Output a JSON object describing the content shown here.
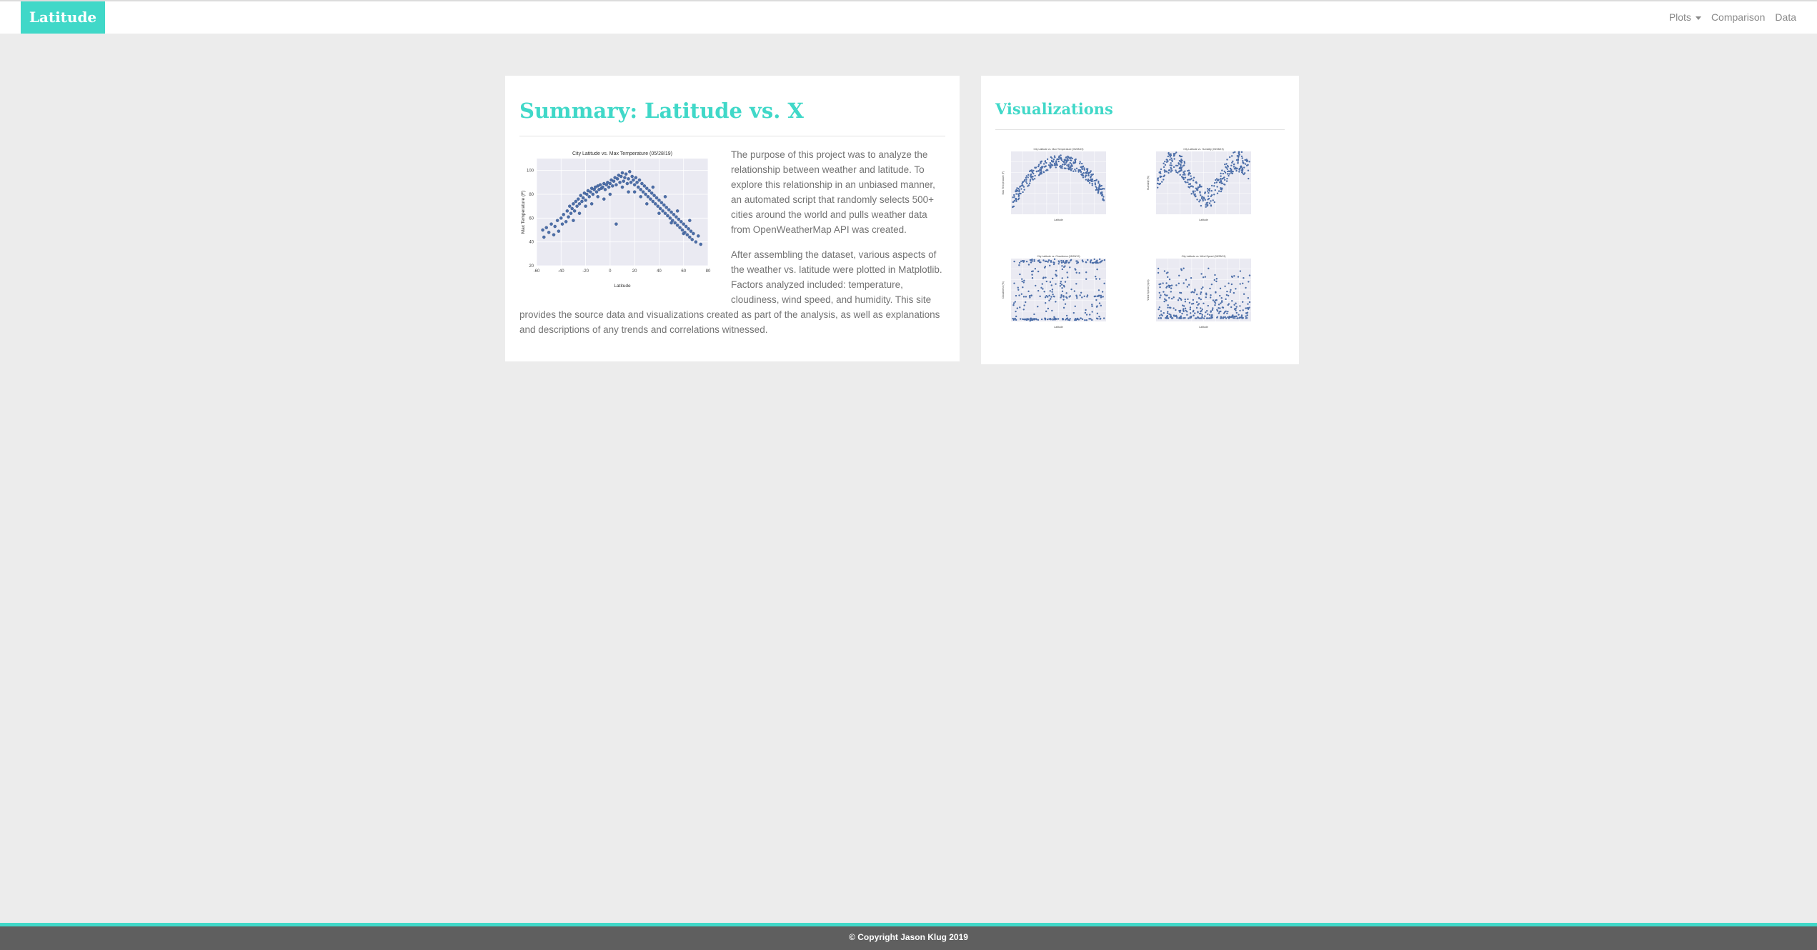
{
  "navbar": {
    "brand": "Latitude",
    "links": [
      {
        "label": "Plots",
        "dropdown": true
      },
      {
        "label": "Comparison",
        "dropdown": false
      },
      {
        "label": "Data",
        "dropdown": false
      }
    ]
  },
  "summary": {
    "title": "Summary: Latitude vs. X",
    "paragraphs": [
      "The purpose of this project was to analyze the relationship between weather and latitude. To explore this relationship in an unbiased manner, an automated script that randomly selects 500+ cities around the world and pulls weather data from OpenWeatherMap API was created.",
      "After assembling the dataset, various aspects of the weather vs. latitude were plotted in Matplotlib. Factors analyzed included: temperature, cloudiness, wind speed, and humidity. This site provides the source data and visualizations created as part of the analysis, as well as explanations and descriptions of any trends and correlations witnessed."
    ]
  },
  "visualizations": {
    "title": "Visualizations"
  },
  "footer": {
    "text": "© Copyright Jason Klug 2019"
  },
  "colors": {
    "accent": "#40d8c8",
    "page_bg": "#ececec",
    "footer_bg": "#5f5f5f",
    "plot_bg": "#eaeaf2",
    "point": "#4c6ea8"
  },
  "chart_data": [
    {
      "type": "scatter",
      "title": "City Latitude vs. Max Temperature (05/28/19)",
      "xlabel": "Latitude",
      "ylabel": "Max Temperature (F)",
      "xticks": [
        "-60",
        "-40",
        "-20",
        "0",
        "20",
        "40",
        "60",
        "80"
      ],
      "yticks": [
        "20",
        "40",
        "60",
        "80",
        "100"
      ],
      "xlim": [
        -60,
        80
      ],
      "ylim": [
        20,
        110
      ],
      "grid": true,
      "trend": "temperature peaks near latitude 0-20 and decreases toward both poles",
      "points": [
        [
          -55,
          50
        ],
        [
          -54,
          44
        ],
        [
          -52,
          52
        ],
        [
          -50,
          48
        ],
        [
          -48,
          55
        ],
        [
          -46,
          46
        ],
        [
          -45,
          53
        ],
        [
          -43,
          58
        ],
        [
          -42,
          49
        ],
        [
          -40,
          60
        ],
        [
          -39,
          55
        ],
        [
          -38,
          63
        ],
        [
          -36,
          57
        ],
        [
          -35,
          66
        ],
        [
          -34,
          61
        ],
        [
          -33,
          70
        ],
        [
          -32,
          64
        ],
        [
          -31,
          68
        ],
        [
          -30,
          72
        ],
        [
          -29,
          66
        ],
        [
          -28,
          74
        ],
        [
          -27,
          70
        ],
        [
          -26,
          76
        ],
        [
          -25,
          72
        ],
        [
          -24,
          79
        ],
        [
          -23,
          74
        ],
        [
          -22,
          77
        ],
        [
          -21,
          81
        ],
        [
          -20,
          75
        ],
        [
          -19,
          80
        ],
        [
          -18,
          83
        ],
        [
          -17,
          78
        ],
        [
          -16,
          82
        ],
        [
          -15,
          85
        ],
        [
          -14,
          80
        ],
        [
          -13,
          84
        ],
        [
          -12,
          86
        ],
        [
          -11,
          82
        ],
        [
          -10,
          87
        ],
        [
          -9,
          84
        ],
        [
          -8,
          88
        ],
        [
          -7,
          85
        ],
        [
          -6,
          86
        ],
        [
          -5,
          89
        ],
        [
          -4,
          84
        ],
        [
          -3,
          88
        ],
        [
          -2,
          90
        ],
        [
          -1,
          86
        ],
        [
          0,
          89
        ],
        [
          1,
          92
        ],
        [
          2,
          87
        ],
        [
          3,
          91
        ],
        [
          4,
          94
        ],
        [
          5,
          88
        ],
        [
          6,
          93
        ],
        [
          7,
          96
        ],
        [
          8,
          90
        ],
        [
          9,
          95
        ],
        [
          10,
          98
        ],
        [
          11,
          91
        ],
        [
          12,
          94
        ],
        [
          13,
          97
        ],
        [
          14,
          89
        ],
        [
          15,
          93
        ],
        [
          16,
          99
        ],
        [
          17,
          90
        ],
        [
          18,
          95
        ],
        [
          19,
          92
        ],
        [
          20,
          88
        ],
        [
          21,
          94
        ],
        [
          22,
          90
        ],
        [
          23,
          86
        ],
        [
          24,
          92
        ],
        [
          25,
          84
        ],
        [
          26,
          89
        ],
        [
          27,
          82
        ],
        [
          28,
          87
        ],
        [
          29,
          80
        ],
        [
          30,
          85
        ],
        [
          31,
          78
        ],
        [
          32,
          83
        ],
        [
          33,
          76
        ],
        [
          34,
          81
        ],
        [
          35,
          74
        ],
        [
          36,
          79
        ],
        [
          37,
          72
        ],
        [
          38,
          77
        ],
        [
          39,
          70
        ],
        [
          40,
          75
        ],
        [
          41,
          68
        ],
        [
          42,
          73
        ],
        [
          43,
          66
        ],
        [
          44,
          71
        ],
        [
          45,
          64
        ],
        [
          46,
          69
        ],
        [
          47,
          62
        ],
        [
          48,
          67
        ],
        [
          49,
          60
        ],
        [
          50,
          65
        ],
        [
          51,
          58
        ],
        [
          52,
          63
        ],
        [
          53,
          56
        ],
        [
          54,
          61
        ],
        [
          55,
          54
        ],
        [
          56,
          59
        ],
        [
          57,
          52
        ],
        [
          58,
          57
        ],
        [
          59,
          50
        ],
        [
          60,
          55
        ],
        [
          61,
          48
        ],
        [
          62,
          53
        ],
        [
          63,
          46
        ],
        [
          64,
          51
        ],
        [
          65,
          44
        ],
        [
          66,
          49
        ],
        [
          67,
          42
        ],
        [
          68,
          47
        ],
        [
          70,
          40
        ],
        [
          72,
          45
        ],
        [
          74,
          38
        ],
        [
          -30,
          58
        ],
        [
          -20,
          70
        ],
        [
          -10,
          78
        ],
        [
          0,
          80
        ],
        [
          10,
          86
        ],
        [
          20,
          82
        ],
        [
          30,
          72
        ],
        [
          40,
          64
        ],
        [
          50,
          56
        ],
        [
          60,
          47
        ],
        [
          5,
          55
        ],
        [
          15,
          82
        ],
        [
          25,
          78
        ],
        [
          35,
          86
        ],
        [
          45,
          78
        ],
        [
          55,
          66
        ],
        [
          65,
          58
        ],
        [
          -5,
          76
        ],
        [
          -15,
          72
        ],
        [
          -25,
          64
        ]
      ]
    },
    {
      "type": "scatter",
      "title": "City Latitude vs. Max Temperature (05/28/19)",
      "xlabel": "Latitude",
      "ylabel": "Max Temperature (F)",
      "shape": "arch"
    },
    {
      "type": "scatter",
      "title": "City Latitude vs. Humidity (05/28/19)",
      "xlabel": "Latitude",
      "ylabel": "Humidity (%)",
      "shape": "wave"
    },
    {
      "type": "scatter",
      "title": "City Latitude vs. Cloudiness (05/28/19)",
      "xlabel": "Latitude",
      "ylabel": "Cloudiness (%)",
      "shape": "bands"
    },
    {
      "type": "scatter",
      "title": "City Latitude vs. Wind Speed (05/28/19)",
      "xlabel": "Latitude",
      "ylabel": "Wind Speed (mph)",
      "shape": "low"
    }
  ]
}
